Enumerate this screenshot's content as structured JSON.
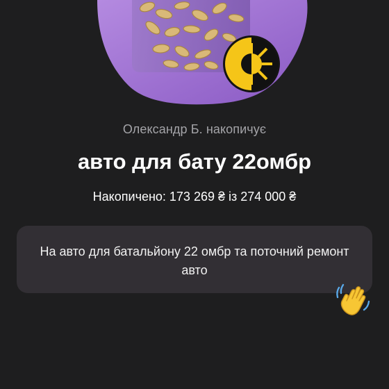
{
  "jar": {
    "owner_text": "Олександр Б. накопичує",
    "title": "авто для бату 22омбр",
    "progress_text": "Накопичено: 173 269 ₴ із 274 000 ₴",
    "progress_fraction": 0.632,
    "description": "На авто для батальйону 22 омбр та поточний ремонт авто"
  },
  "icons": {
    "jar": "coin-jar-icon",
    "avatar": "sun-emblem-icon",
    "wave": "waving-hand-icon"
  },
  "colors": {
    "background": "#1e1e1f",
    "accent_purple": "#9463cc",
    "card": "#322f34",
    "secondary_text": "#a4a4a8",
    "emblem_yellow": "#f5c518"
  }
}
